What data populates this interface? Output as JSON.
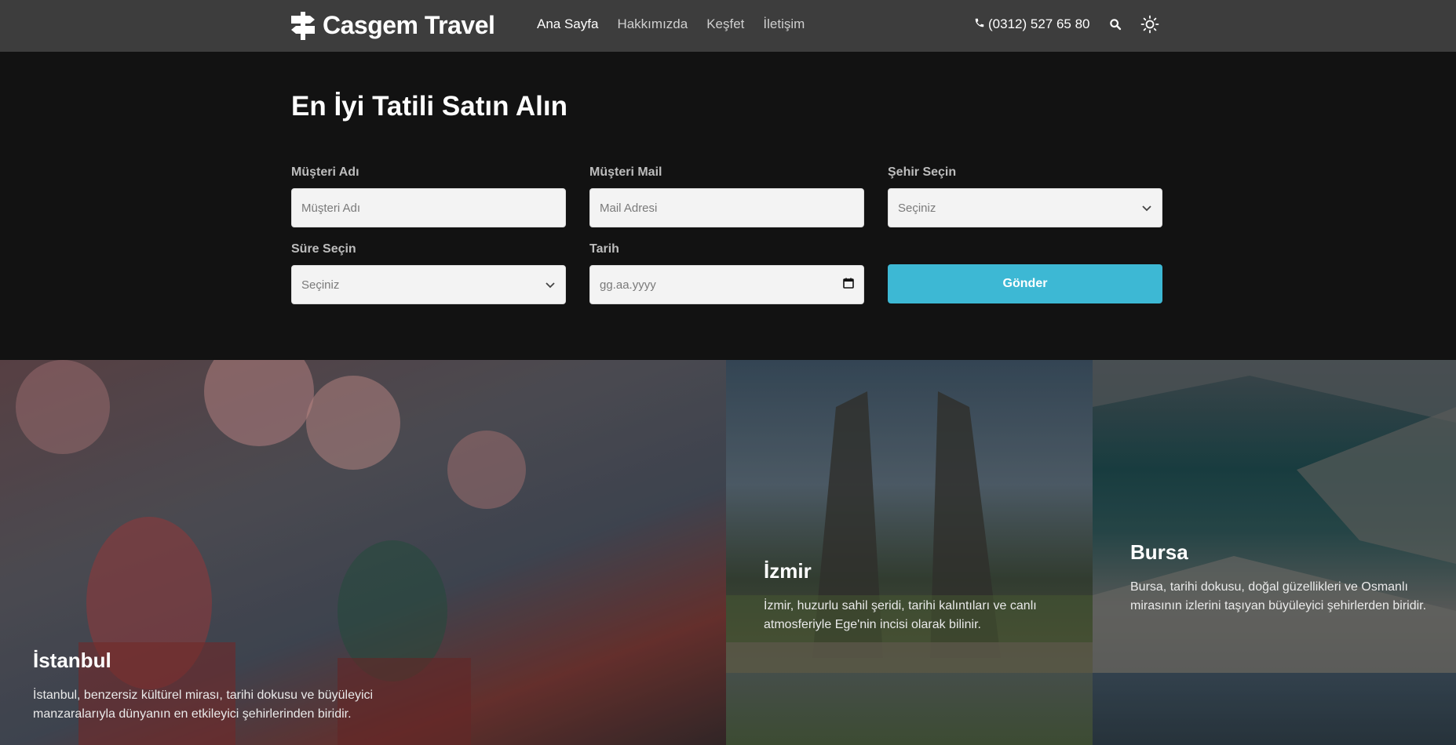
{
  "brand": {
    "name": "Casgem Travel",
    "logo_icon": "signpost-icon"
  },
  "nav": {
    "links": [
      {
        "label": "Ana Sayfa",
        "active": true
      },
      {
        "label": "Hakkımızda",
        "active": false
      },
      {
        "label": "Keşfet",
        "active": false
      },
      {
        "label": "İletişim",
        "active": false
      }
    ],
    "phone": "(0312) 527 65 80",
    "phone_icon": "phone-icon",
    "search_icon": "search-icon",
    "theme_icon": "sun-icon"
  },
  "hero": {
    "title": "En İyi Tatili Satın Alın",
    "form": {
      "name_label": "Müşteri Adı",
      "name_placeholder": "Müşteri Adı",
      "mail_label": "Müşteri Mail",
      "mail_placeholder": "Mail Adresi",
      "city_label": "Şehir Seçin",
      "city_value": "Seçiniz",
      "duration_label": "Süre Seçin",
      "duration_value": "Seçiniz",
      "date_label": "Tarih",
      "date_placeholder": "gg.aa.yyyy",
      "submit_label": "Gönder"
    }
  },
  "destinations": [
    {
      "title": "İstanbul",
      "desc": "İstanbul, benzersiz kültürel mirası, tarihi dokusu ve büyüleyici manzaralarıyla dünyanın en etkileyici şehirlerinden biridir."
    },
    {
      "title": "İzmir",
      "desc": "İzmir, huzurlu sahil şeridi, tarihi kalıntıları ve canlı atmosferiyle Ege'nin incisi olarak bilinir."
    },
    {
      "title": "Bursa",
      "desc": "Bursa, tarihi dokusu, doğal güzellikleri ve Osmanlı mirasının izlerini taşıyan büyüleyici şehirlerden biridir."
    }
  ],
  "colors": {
    "navbar": "#3d3d3d",
    "hero_bg": "#121212",
    "accent": "#3db8d4"
  }
}
